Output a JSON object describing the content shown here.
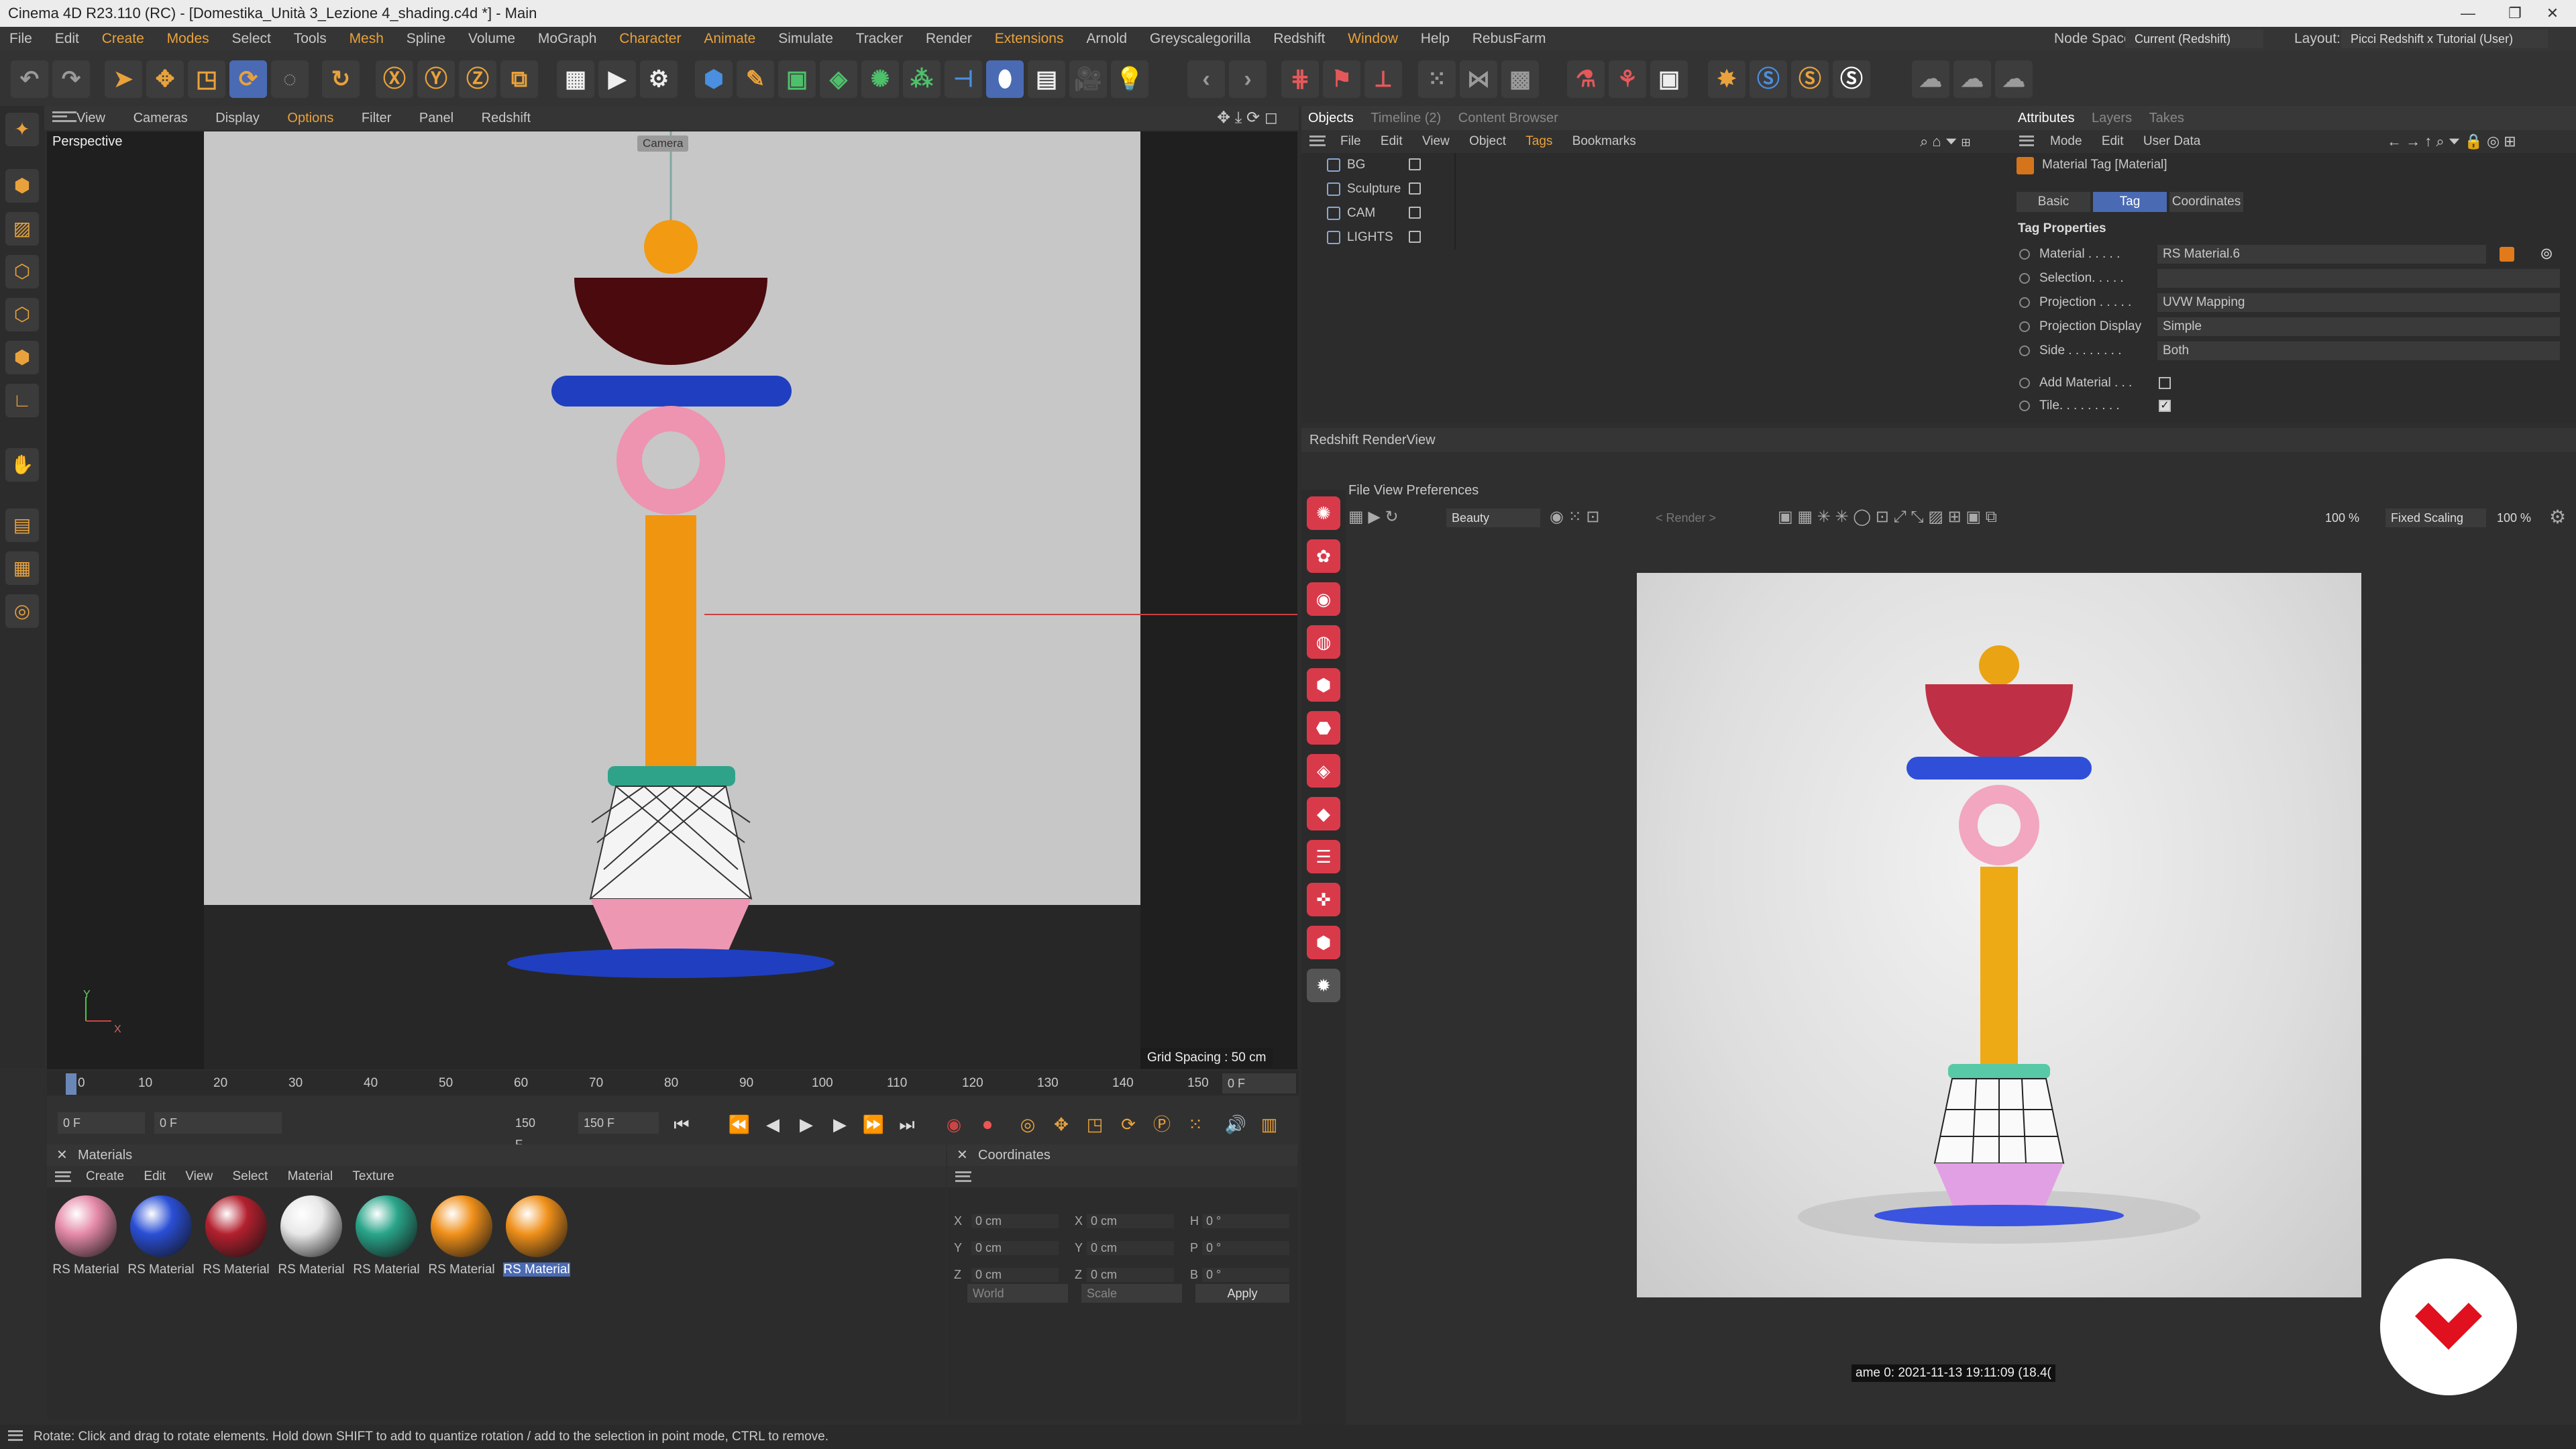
{
  "window": {
    "title": "Cinema 4D R23.110 (RC) - [Domestika_Unità 3_Lezione 4_shading.c4d *] - Main"
  },
  "menu": [
    "File",
    "Edit",
    "Create",
    "Modes",
    "Select",
    "Tools",
    "Mesh",
    "Spline",
    "Volume",
    "MoGraph",
    "Character",
    "Animate",
    "Simulate",
    "Tracker",
    "Render",
    "Extensions",
    "Arnold",
    "Greyscalegorilla",
    "Redshift",
    "Window",
    "Help",
    "RebusFarm"
  ],
  "node_space": {
    "label": "Node Space:",
    "value": "Current (Redshift)"
  },
  "layout": {
    "label": "Layout:",
    "value": "Picci Redshift x Tutorial (User)"
  },
  "viewport": {
    "menu": [
      "View",
      "Cameras",
      "Display",
      "Options",
      "Filter",
      "Panel",
      "Redshift"
    ],
    "label": "Perspective",
    "camera_label": "Camera",
    "grid_spacing": "Grid Spacing : 50 cm",
    "axis_y": "Y",
    "axis_x": "X"
  },
  "timeline": {
    "ticks": [
      "0",
      "10",
      "20",
      "30",
      "40",
      "50",
      "60",
      "70",
      "80",
      "90",
      "100",
      "110",
      "120",
      "130",
      "140",
      "150"
    ],
    "frame_end": "0 F",
    "start": "0 F",
    "range_start": "0 F",
    "range_end": "150 F",
    "end": "150 F"
  },
  "materials": {
    "title": "Materials",
    "menu": [
      "Create",
      "Edit",
      "View",
      "Select",
      "Material",
      "Texture"
    ],
    "items": [
      {
        "label": "RS Material",
        "color": "#e58aa8"
      },
      {
        "label": "RS Material",
        "color": "#2a4fd6"
      },
      {
        "label": "RS Material",
        "color": "#b3202e"
      },
      {
        "label": "RS Material",
        "color": "#e8e8e8"
      },
      {
        "label": "RS Material",
        "color": "#2aa58a"
      },
      {
        "label": "RS Material",
        "color": "#f0901a"
      },
      {
        "label": "RS Material",
        "color": "#f0901a"
      }
    ]
  },
  "coordinates": {
    "title": "Coordinates",
    "rows": [
      {
        "a": "X",
        "av": "0 cm",
        "b": "X",
        "bv": "0 cm",
        "c": "H",
        "cv": "0 °"
      },
      {
        "a": "Y",
        "av": "0 cm",
        "b": "Y",
        "bv": "0 cm",
        "c": "P",
        "cv": "0 °"
      },
      {
        "a": "Z",
        "av": "0 cm",
        "b": "Z",
        "bv": "0 cm",
        "c": "B",
        "cv": "0 °"
      }
    ],
    "space": "World",
    "mode": "Scale",
    "apply": "Apply"
  },
  "objects": {
    "tabs": [
      "Objects",
      "Timeline (2)",
      "Content Browser"
    ],
    "menu": [
      "File",
      "Edit",
      "View",
      "Object",
      "Tags",
      "Bookmarks"
    ],
    "items": [
      "BG",
      "Sculpture",
      "CAM",
      "LIGHTS"
    ]
  },
  "attributes": {
    "tabs": [
      "Attributes",
      "Layers",
      "Takes"
    ],
    "menu": [
      "Mode",
      "Edit",
      "User Data"
    ],
    "header": "Material Tag [Material]",
    "subtabs": [
      "Basic",
      "Tag",
      "Coordinates"
    ],
    "section": "Tag Properties",
    "rows": [
      {
        "label": "Material . . . . .",
        "value": "RS Material.6"
      },
      {
        "label": "Selection. . . . .",
        "value": ""
      },
      {
        "label": "Projection . . . . .",
        "value": "UVW Mapping"
      },
      {
        "label": "Projection Display",
        "value": "Simple"
      },
      {
        "label": "Side . . . . . . . .",
        "value": "Both"
      }
    ],
    "add_material": "Add Material . . .",
    "tile": "Tile. . . . . . . . ."
  },
  "renderview": {
    "title": "Redshift RenderView",
    "menu": [
      "File",
      "View",
      "Preferences"
    ],
    "aov": "Beauty",
    "render_dd": "< Render >",
    "zoom1": "100 %",
    "scaling": "Fixed Scaling",
    "zoom2": "100 %",
    "frame_info": "ame 0:  2021-11-13  19:11:09  (18.4("
  },
  "status": "Rotate: Click and drag to rotate elements. Hold down SHIFT to add to quantize rotation / add to the selection in point mode, CTRL to remove."
}
